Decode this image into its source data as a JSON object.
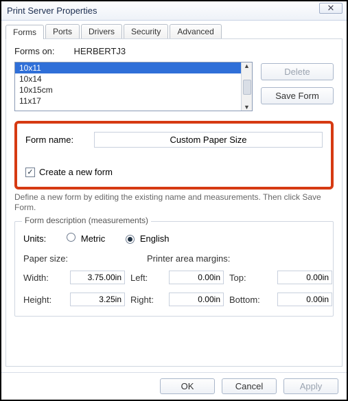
{
  "window": {
    "title": "Print Server Properties"
  },
  "tabs": [
    "Forms",
    "Ports",
    "Drivers",
    "Security",
    "Advanced"
  ],
  "forms_on": {
    "label": "Forms on:",
    "value": "HERBERTJ3"
  },
  "form_list": [
    "10x11",
    "10x14",
    "10x15cm",
    "11x17"
  ],
  "side_buttons": {
    "delete": "Delete",
    "save": "Save Form"
  },
  "form_name": {
    "label": "Form name:",
    "value": "Custom Paper Size"
  },
  "create_new": {
    "label": "Create a new form",
    "checked": true
  },
  "hint": "Define a new form by editing the existing name and measurements. Then click Save Form.",
  "fieldset_title": "Form description (measurements)",
  "units": {
    "label": "Units:",
    "metric": "Metric",
    "english": "English",
    "selected": "english"
  },
  "sections": {
    "paper_size": "Paper size:",
    "margins": "Printer area margins:"
  },
  "measure": {
    "width_label": "Width:",
    "width": "3.75.00in",
    "height_label": "Height:",
    "height": "3.25in",
    "left_label": "Left:",
    "left": "0.00in",
    "right_label": "Right:",
    "right": "0.00in",
    "top_label": "Top:",
    "top": "0.00in",
    "bottom_label": "Bottom:",
    "bottom": "0.00in"
  },
  "footer": {
    "ok": "OK",
    "cancel": "Cancel",
    "apply": "Apply"
  }
}
